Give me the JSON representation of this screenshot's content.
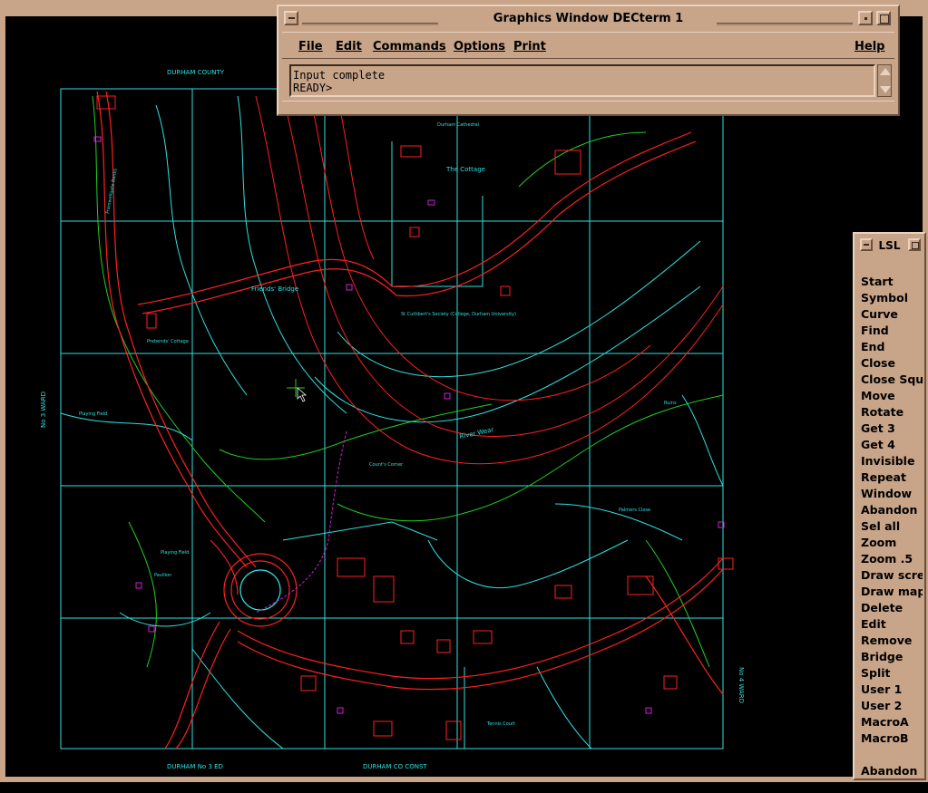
{
  "decterm": {
    "title": "Graphics Window DECterm 1",
    "menu": [
      "File",
      "Edit",
      "Commands",
      "Options",
      "Print",
      "Help"
    ],
    "output_line_1": "Input complete",
    "output_line_2": "READY>"
  },
  "lsl": {
    "title": "LSL",
    "items": [
      "Start",
      "Symbol",
      "Curve",
      "Find",
      "End",
      "Close",
      "Close Squ",
      "Move",
      "Rotate",
      "Get 3",
      "Get 4",
      "Invisible",
      "Repeat",
      "Window",
      "Abandon",
      "Sel all",
      "Zoom",
      "Zoom .5",
      "Draw scre",
      "Draw map",
      "Delete",
      "Edit",
      "Remove",
      "Bridge",
      "Split",
      "User 1",
      "User 2",
      "MacroA",
      "MacroB"
    ],
    "footer_item": "Abandon"
  },
  "map": {
    "top_label": "DURHAM COUNTY",
    "left_label": "No 3 WARD",
    "right_label": "No 4 WARD",
    "bottom_label_left": "DURHAM No 3 ED",
    "bottom_label_right": "DURHAM CO CONST",
    "labels": [
      "Framwellgate Banks",
      "Friends' Bridge",
      "River Wear",
      "The Cottage",
      "St Cuthbert's Society (College, Durham University)",
      "Count's Corner",
      "Prebends' Cottage",
      "Playing Field",
      "Pavilion",
      "Palmers Close",
      "Tennis Court",
      "Durham Cathedral",
      "Ruins"
    ],
    "colors": {
      "background": "#000000",
      "grid": "#2fe0e0",
      "roads": "#ff2020",
      "river": "#ff2020",
      "paths": "#20d020",
      "footpath": "#d020d0",
      "buildings": "#ff2020",
      "labels": "#2fe0e0"
    }
  },
  "colors": {
    "chrome": "#c8a489",
    "chrome_light": "#e9d2bf",
    "chrome_dark": "#6a4f3c"
  }
}
